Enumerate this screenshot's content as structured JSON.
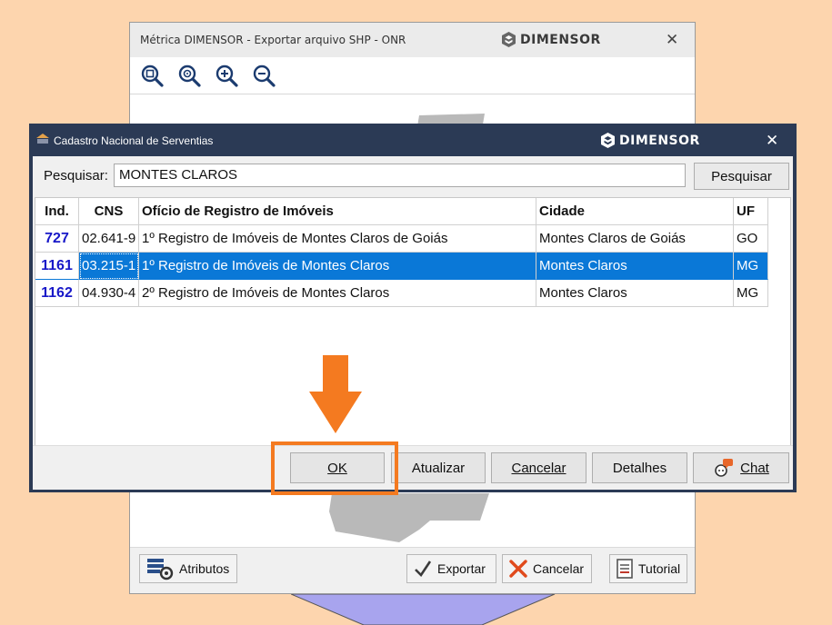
{
  "back_window": {
    "title": "Métrica DIMENSOR - Exportar arquivo SHP - ONR",
    "logo": "DIMENSOR",
    "close": "✕",
    "zoom_icons": [
      "zoom-extent-icon",
      "zoom-center-icon",
      "zoom-in-icon",
      "zoom-out-icon"
    ],
    "bottom_buttons": {
      "atributos": "Atributos",
      "exportar": "Exportar",
      "cancelar": "Cancelar",
      "tutorial": "Tutorial"
    }
  },
  "dialog": {
    "title": "Cadastro Nacional de Serventias",
    "logo": "DIMENSOR",
    "close": "✕",
    "search": {
      "label": "Pesquisar:",
      "value": "MONTES CLAROS",
      "button": "Pesquisar"
    },
    "table": {
      "columns": [
        "Ind.",
        "CNS",
        "Ofício de Registro de Imóveis",
        "Cidade",
        "UF"
      ],
      "rows": [
        {
          "ind": "727",
          "cns": "02.641-9",
          "oficio": "1º Registro de Imóveis de Montes Claros de Goiás",
          "cidade": "Montes Claros de Goiás",
          "uf": "GO"
        },
        {
          "ind": "1161",
          "cns": "03.215-1",
          "oficio": "1º Registro de Imóveis de Montes Claros",
          "cidade": "Montes Claros",
          "uf": "MG"
        },
        {
          "ind": "1162",
          "cns": "04.930-4",
          "oficio": "2º Registro de Imóveis de Montes Claros",
          "cidade": "Montes Claros",
          "uf": "MG"
        }
      ],
      "selected_index": 1
    },
    "buttons": {
      "ok": "OK",
      "atualizar": "Atualizar",
      "cancelar": "Cancelar",
      "detalhes": "Detalhes",
      "chat": "Chat"
    }
  },
  "colors": {
    "background": "#fdd5ae",
    "dialog_frame": "#2b3a55",
    "selection": "#0a78d7",
    "annotation": "#f47a20",
    "index_text": "#1818c8"
  }
}
